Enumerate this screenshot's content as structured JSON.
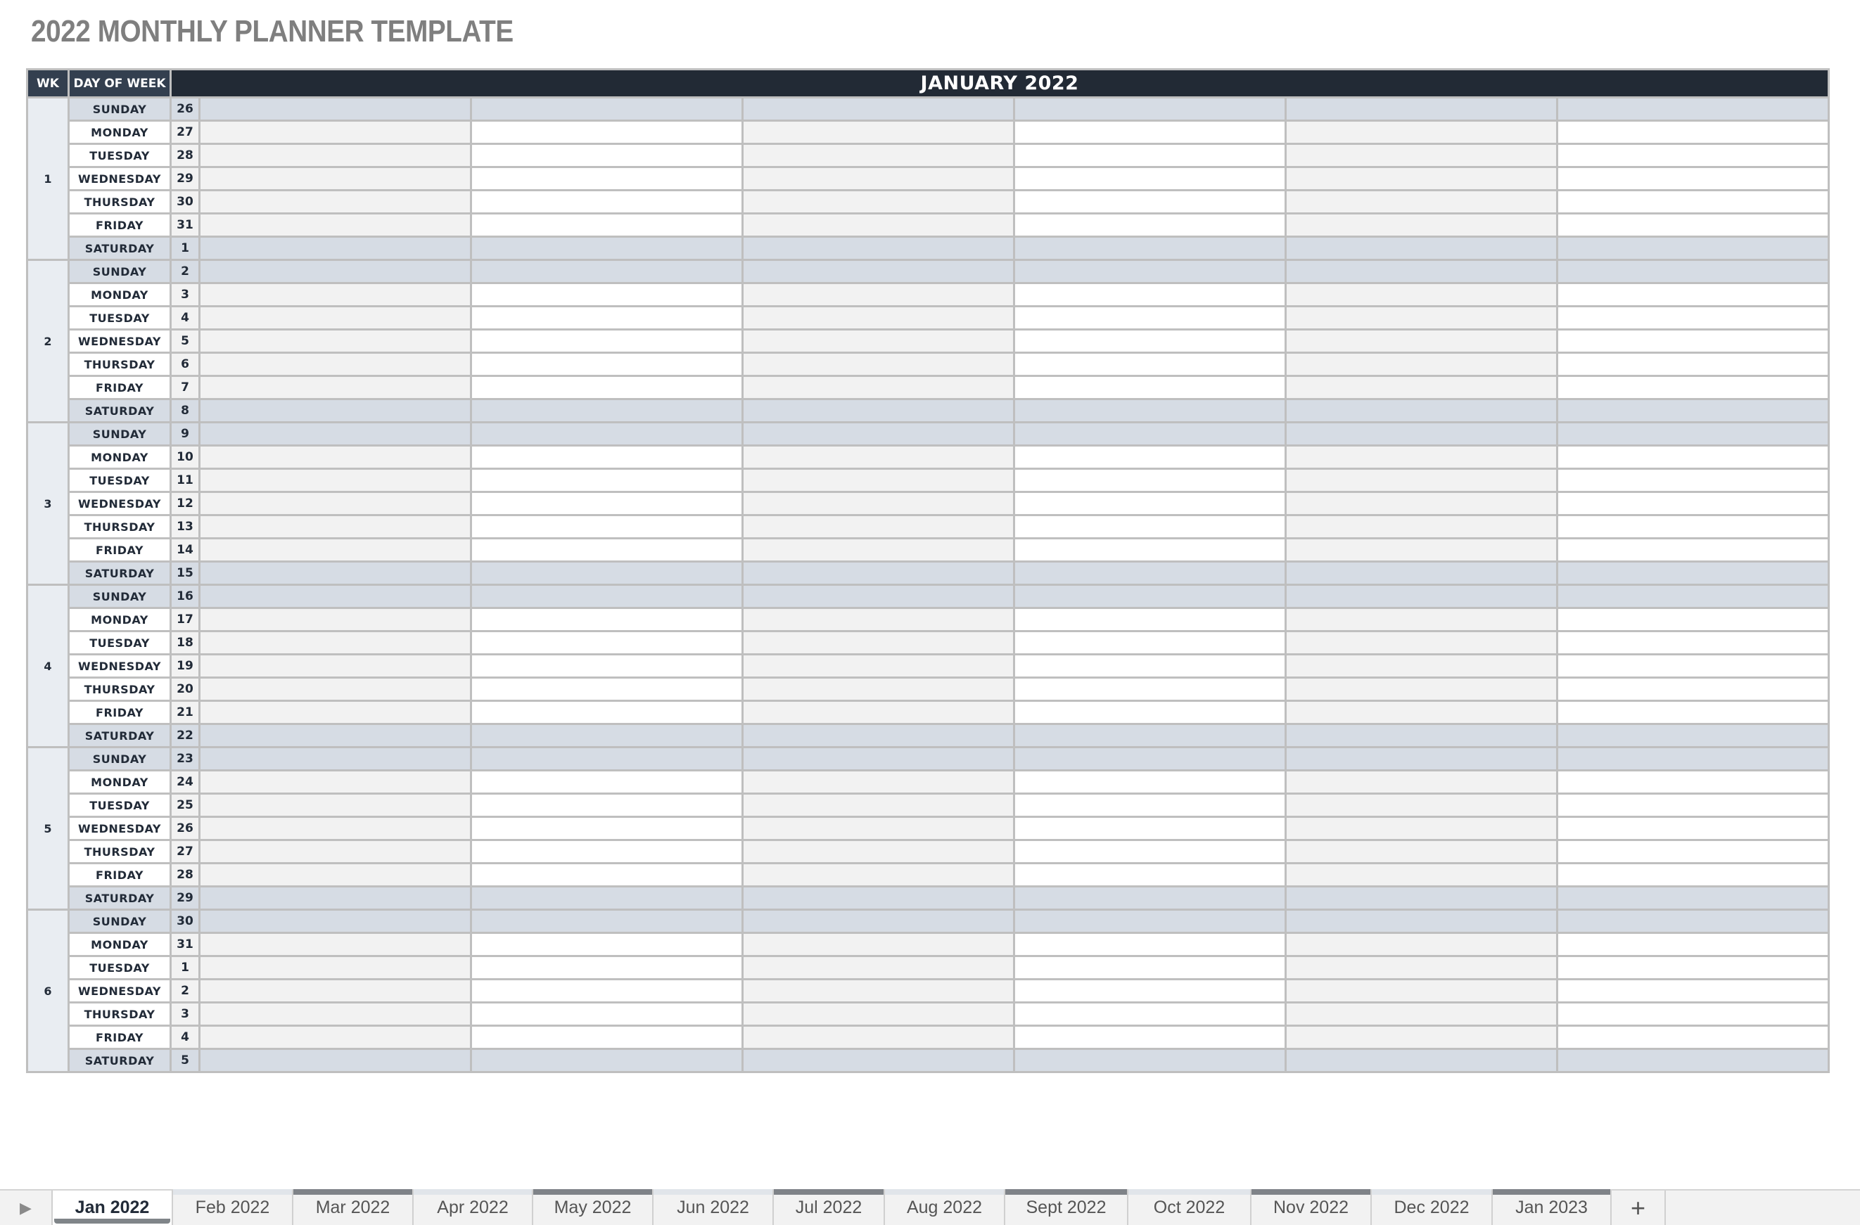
{
  "title": "2022 MONTHLY PLANNER TEMPLATE",
  "table": {
    "headers": {
      "wk": "WK",
      "day_of_week": "DAY OF WEEK",
      "month": "JANUARY 2022"
    },
    "weeks": [
      {
        "wk": "1",
        "days": [
          {
            "dow": "SUNDAY",
            "date": "26"
          },
          {
            "dow": "MONDAY",
            "date": "27"
          },
          {
            "dow": "TUESDAY",
            "date": "28"
          },
          {
            "dow": "WEDNESDAY",
            "date": "29"
          },
          {
            "dow": "THURSDAY",
            "date": "30"
          },
          {
            "dow": "FRIDAY",
            "date": "31"
          },
          {
            "dow": "SATURDAY",
            "date": "1"
          }
        ]
      },
      {
        "wk": "2",
        "days": [
          {
            "dow": "SUNDAY",
            "date": "2"
          },
          {
            "dow": "MONDAY",
            "date": "3"
          },
          {
            "dow": "TUESDAY",
            "date": "4"
          },
          {
            "dow": "WEDNESDAY",
            "date": "5"
          },
          {
            "dow": "THURSDAY",
            "date": "6"
          },
          {
            "dow": "FRIDAY",
            "date": "7"
          },
          {
            "dow": "SATURDAY",
            "date": "8"
          }
        ]
      },
      {
        "wk": "3",
        "days": [
          {
            "dow": "SUNDAY",
            "date": "9"
          },
          {
            "dow": "MONDAY",
            "date": "10"
          },
          {
            "dow": "TUESDAY",
            "date": "11"
          },
          {
            "dow": "WEDNESDAY",
            "date": "12"
          },
          {
            "dow": "THURSDAY",
            "date": "13"
          },
          {
            "dow": "FRIDAY",
            "date": "14"
          },
          {
            "dow": "SATURDAY",
            "date": "15"
          }
        ]
      },
      {
        "wk": "4",
        "days": [
          {
            "dow": "SUNDAY",
            "date": "16"
          },
          {
            "dow": "MONDAY",
            "date": "17"
          },
          {
            "dow": "TUESDAY",
            "date": "18"
          },
          {
            "dow": "WEDNESDAY",
            "date": "19"
          },
          {
            "dow": "THURSDAY",
            "date": "20"
          },
          {
            "dow": "FRIDAY",
            "date": "21"
          },
          {
            "dow": "SATURDAY",
            "date": "22"
          }
        ]
      },
      {
        "wk": "5",
        "days": [
          {
            "dow": "SUNDAY",
            "date": "23"
          },
          {
            "dow": "MONDAY",
            "date": "24"
          },
          {
            "dow": "TUESDAY",
            "date": "25"
          },
          {
            "dow": "WEDNESDAY",
            "date": "26"
          },
          {
            "dow": "THURSDAY",
            "date": "27"
          },
          {
            "dow": "FRIDAY",
            "date": "28"
          },
          {
            "dow": "SATURDAY",
            "date": "29"
          }
        ]
      },
      {
        "wk": "6",
        "days": [
          {
            "dow": "SUNDAY",
            "date": "30"
          },
          {
            "dow": "MONDAY",
            "date": "31"
          },
          {
            "dow": "TUESDAY",
            "date": "1"
          },
          {
            "dow": "WEDNESDAY",
            "date": "2"
          },
          {
            "dow": "THURSDAY",
            "date": "3"
          },
          {
            "dow": "FRIDAY",
            "date": "4"
          },
          {
            "dow": "SATURDAY",
            "date": "5"
          }
        ]
      }
    ],
    "note_columns": 6
  },
  "sheet_tabs": {
    "nav_icon": "play-right-icon",
    "tabs": [
      {
        "label": "Jan 2022",
        "active": true,
        "color": ""
      },
      {
        "label": "Feb 2022",
        "active": false,
        "color": "#e1e5ea"
      },
      {
        "label": "Mar 2022",
        "active": false,
        "color": "#7f8388"
      },
      {
        "label": "Apr 2022",
        "active": false,
        "color": "#e1e5ea"
      },
      {
        "label": "May 2022",
        "active": false,
        "color": "#7f8388"
      },
      {
        "label": "Jun 2022",
        "active": false,
        "color": "#e1e5ea"
      },
      {
        "label": "Jul 2022",
        "active": false,
        "color": "#7f8388"
      },
      {
        "label": "Aug 2022",
        "active": false,
        "color": "#e1e5ea"
      },
      {
        "label": "Sept 2022",
        "active": false,
        "color": "#7f8388"
      },
      {
        "label": "Oct 2022",
        "active": false,
        "color": "#e1e5ea"
      },
      {
        "label": "Nov 2022",
        "active": false,
        "color": "#7f8388"
      },
      {
        "label": "Dec 2022",
        "active": false,
        "color": "#e1e5ea"
      },
      {
        "label": "Jan 2023",
        "active": false,
        "color": "#7f8388"
      }
    ],
    "add_label": "+"
  },
  "colors": {
    "header_dark": "#222a35",
    "header_mid": "#333f4f",
    "weekend_fill": "#d6dce4",
    "week_fill": "#e9edf2",
    "alt_gray": "#f2f2f2",
    "grid": "#bfbfbf",
    "title": "#7f7f7f"
  }
}
